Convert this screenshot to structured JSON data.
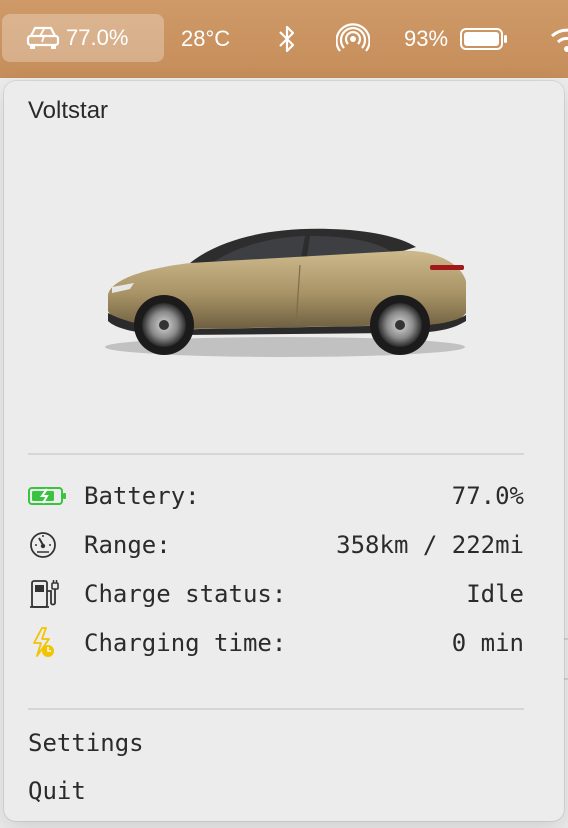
{
  "menubar": {
    "app_battery": "77.0%",
    "temperature": "28°C",
    "system_battery": "93%"
  },
  "menu": {
    "title": "Voltstar",
    "stats": [
      {
        "label": "Battery:",
        "value": "77.0%",
        "icon": "battery-charging-icon"
      },
      {
        "label": "Range:",
        "value": "358km / 222mi",
        "icon": "speedometer-icon"
      },
      {
        "label": "Charge status:",
        "value": "Idle",
        "icon": "ev-charger-icon"
      },
      {
        "label": "Charging time:",
        "value": "0 min",
        "icon": "charging-time-icon"
      }
    ],
    "settings_label": "Settings",
    "quit_label": "Quit"
  },
  "colors": {
    "menubar_bg": "#c9925f",
    "car_body": "#b4a276",
    "battery_green": "#39c33f",
    "charge_yellow": "#f2c300"
  }
}
